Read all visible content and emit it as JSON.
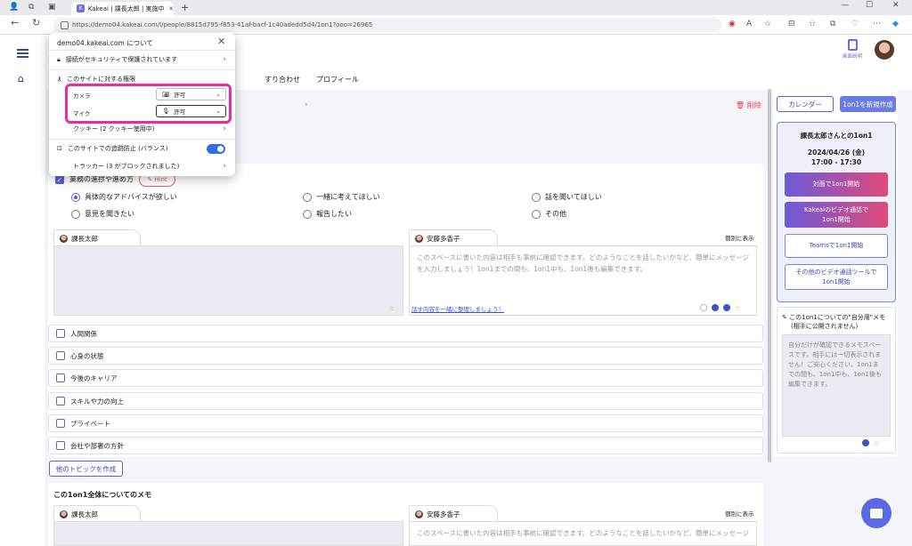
{
  "browser": {
    "tab_title": "Kakeai | 課長太郎 | 実施中の1on1",
    "tab_favicon": "K",
    "url": "https://demo04.kakeai.com/l/people/8815d795-f853-41af-bacf-1c40adedd5d4/1on1?ooo=26965"
  },
  "header": {
    "tabs": [
      "すり合わせ",
      "プロフィール"
    ],
    "user_icon_label": "画面説明"
  },
  "popup": {
    "title": "demo04.kakeai.com について",
    "secure_label": "接続がセキュリティで保護されています",
    "permissions_title": "このサイトに対する権限",
    "camera_label": "カメラ",
    "camera_value": "許可",
    "mic_label": "マイク",
    "mic_value": "許可",
    "cookie_label": "クッキー (2 クッキー使用中)",
    "tracking_label": "このサイトでの追跡防止 (バランス)",
    "tracker_label": "トラッカー (3 がブロックされました)"
  },
  "main": {
    "delete_label": "削除",
    "topic_label": "業務の進捗や進め方",
    "hint_label": "Hint",
    "options": [
      {
        "label": "具体的なアドバイスが欲しい",
        "selected": true
      },
      {
        "label": "一緒に考えてほしい",
        "selected": false
      },
      {
        "label": "話を聞いてほしい",
        "selected": false
      },
      {
        "label": "意見を聞きたい",
        "selected": false
      },
      {
        "label": "報告したい",
        "selected": false
      },
      {
        "label": "その他",
        "selected": false
      }
    ],
    "left_author": "課長太郎",
    "right_author": "安藤多香子",
    "private_label": "個別に表示",
    "right_placeholder": "このスペースに書いた内容は相手も事前に確認できます。どのようなことを話したいかなど、簡単にメッセージを入力しましょう！1on1までの間も、1on1中も、1on1後も編集できます。",
    "organize_link": "話す内容を一緒に整理しましょう！",
    "topics": [
      "人間関係",
      "心身の状態",
      "今後のキャリア",
      "スキルや力の向上",
      "プライベート",
      "会社や部署の方針"
    ],
    "create_topic": "他のトピックを作成",
    "memo_title": "この1on1全体についてのメモ",
    "memo_left_author": "課長太郎",
    "memo_right_author": "安藤多香子",
    "memo_private_label": "個別に表示",
    "memo_placeholder": "このスペースに書いた内容は相手も事前に確認できます。どのようなことを話したいかなど、簡単にメッセージ"
  },
  "sidebar": {
    "calendar_btn": "カレンダー",
    "new_btn": "1on1を新規作成",
    "session_title": "課長太郎さんとの1on1",
    "session_date": "2024/04/26 (金)",
    "session_time": "17:00 - 17:30",
    "btn_face": "対面で1on1開始",
    "btn_video_1": "Kakeaiのビデオ通話で",
    "btn_video_2": "1on1開始",
    "btn_teams": "Teamsで1on1開始",
    "btn_other_1": "その他のビデオ通話ツールで",
    "btn_other_2": "1on1開始",
    "memo_head": "この1on1についての\"自分用\"メモ",
    "memo_sub": "(相手に公開されません)",
    "memo_placeholder": "自分だけが確認できるメモスペースです。相手には一切表示されません！ご安心ください。1on1までの間も、1on1中も、1on1後も編集できます。"
  },
  "colors": {
    "accent": "#5b63d3",
    "highlight": "#e62ea0",
    "danger": "#e04848"
  }
}
